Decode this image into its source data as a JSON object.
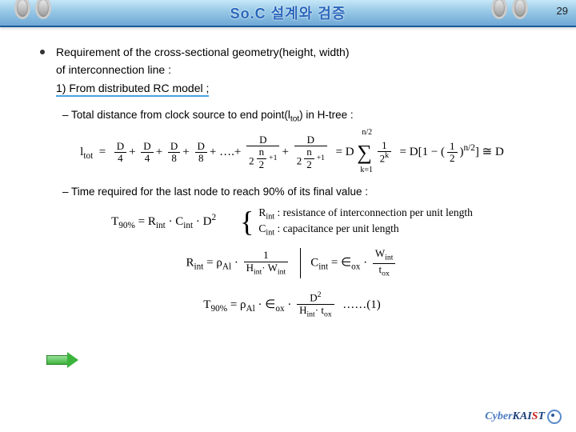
{
  "header": {
    "title": "So.C 설계와 검증",
    "page_number": "29"
  },
  "body": {
    "main_bullet_line1": "Requirement of the cross-sectional geometry(height, width)",
    "main_bullet_line2": "of interconnection line :",
    "item1": "1) From distributed RC model ;",
    "sub1_prefix": "– Total distance from clock source to end point(l",
    "sub1_sub": "tot",
    "sub1_suffix": ") in H-tree :",
    "sub2": "– Time required for the last node to reach 90% of its final value :",
    "brace_line1": "Rint : resistance of interconnection per unit length",
    "brace_line2": "Cint : capacitance per unit length"
  },
  "formulas": {
    "ltot": {
      "lhs": "l",
      "lhs_sub": "tot",
      "terms_D": "D",
      "den1": "4",
      "den2": "4",
      "den3": "8",
      "den4": "8",
      "dots": "….",
      "den5a": "2",
      "exp5a": "+1",
      "den5b": "2",
      "exp5b": "+1",
      "sum_prefix": "= D",
      "sum_upper": "n/2",
      "sum_lower": "k=1",
      "sum_inner_num": "1",
      "sum_inner_den_base": "2",
      "sum_inner_den_exp": "k",
      "expand": "= D[1 − (",
      "expand_frac_num": "1",
      "expand_frac_den": "2",
      "expand_exp": "n/2",
      "expand_close": ")       ] ≅ D",
      "n_over_2": "n",
      "two": "2"
    },
    "t90": {
      "lhs": "T",
      "lhs_sub": "90%",
      "eq": "= R",
      "r_sub": "int",
      "dot1": "· C",
      "c_sub": "int",
      "dot2": "· D",
      "d_exp": "2"
    },
    "rint": {
      "lhs": "R",
      "lhs_sub": "int",
      "eq": "= ρ",
      "rho_sub": "Al",
      "dot": "·",
      "num": "1",
      "den1": "H",
      "den1_sub": "int",
      "den_mid": "· W",
      "den2_sub": "int"
    },
    "cint": {
      "lhs": "C",
      "lhs_sub": "int",
      "eq": "= ∈",
      "eps_sub": "ox",
      "dot": "·",
      "num": "W",
      "num_sub": "int",
      "den": "t",
      "den_sub": "ox"
    },
    "final": {
      "lhs": "T",
      "lhs_sub": "90%",
      "eq": "= ρ",
      "rho_sub": "Al",
      "dot1": "· ∈",
      "eps_sub": "ox",
      "dot2": "·",
      "num": "D",
      "num_exp": "2",
      "den1": "H",
      "den1_sub": "int",
      "den_mid": "· t",
      "den2_sub": "ox",
      "tail": "……(1)"
    }
  },
  "footer": {
    "logo_cyber": "Cyber",
    "logo_kai": "KAI",
    "logo_s": "S",
    "logo_t": "T"
  },
  "icons": {
    "arrow": "green-right-arrow"
  }
}
